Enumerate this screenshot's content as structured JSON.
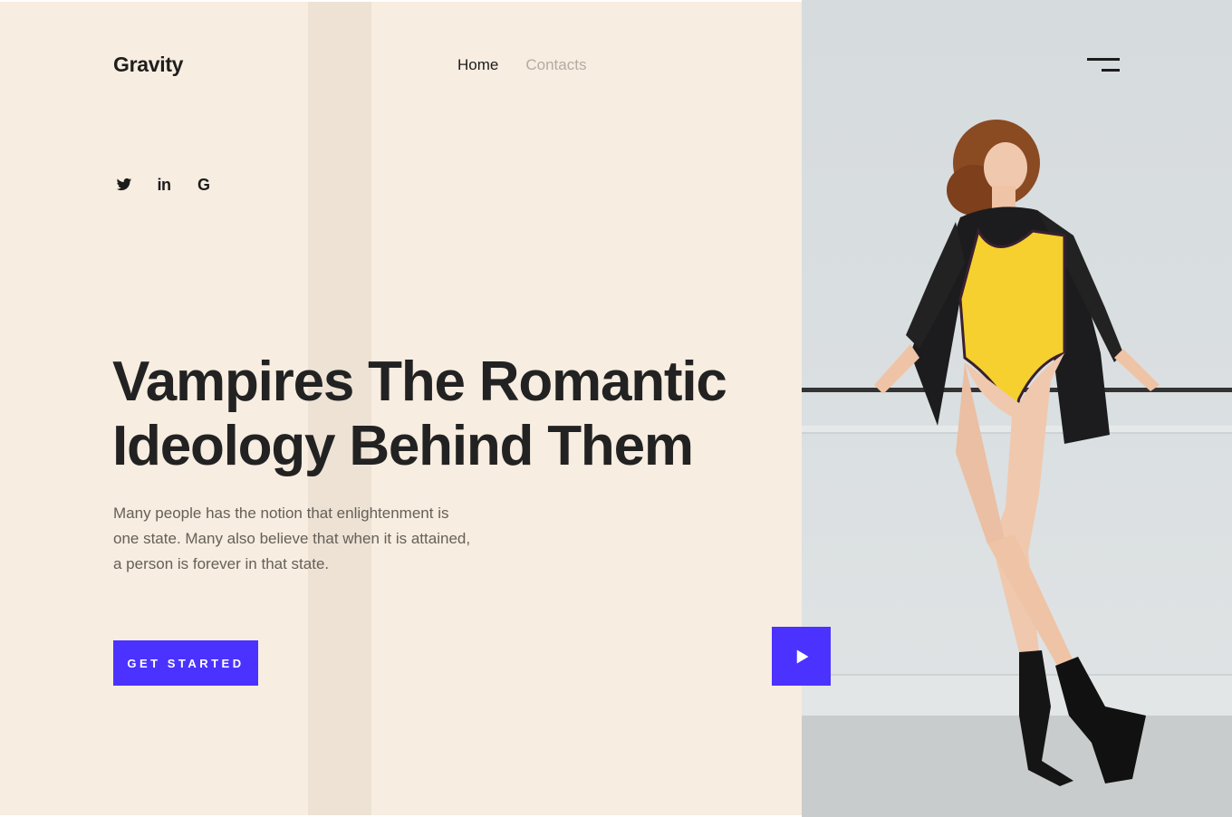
{
  "brand": {
    "logo": "Gravity"
  },
  "nav": {
    "items": [
      {
        "label": "Home",
        "active": true
      },
      {
        "label": "Contacts",
        "active": false
      }
    ]
  },
  "socials": {
    "icons": [
      "twitter-icon",
      "linkedin-icon",
      "google-icon"
    ],
    "linkedin_glyph": "in",
    "google_glyph": "G"
  },
  "hero": {
    "title_lines": [
      "Vampires The Romantic",
      "Ideology Behind Them"
    ],
    "description_lines": [
      "Many people has the notion that enlightenment is",
      "one state. Many also believe that when it is attained,",
      "a person is forever in that state."
    ],
    "cta_label": "GET STARTED"
  },
  "colors": {
    "panel_bg": "#f7ede0",
    "stripe": "#ede2d4",
    "accent": "#4b32ff",
    "heading": "#222222",
    "body_text": "#666058",
    "nav_inactive": "#b3aca3"
  },
  "media": {
    "play_icon": "play-icon",
    "menu_icon": "hamburger-menu-icon"
  }
}
